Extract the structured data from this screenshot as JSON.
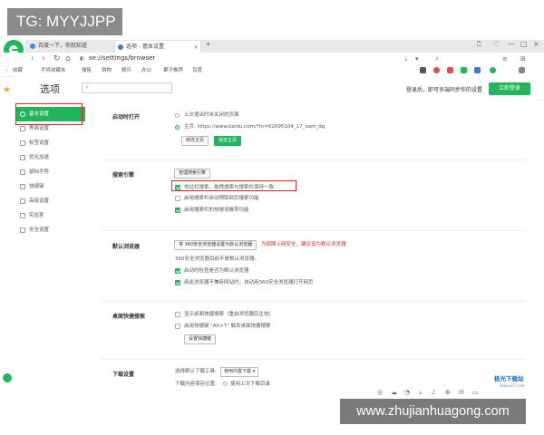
{
  "overlay_tag": "TG: MYYJJPP",
  "tabs": [
    {
      "label": "百度一下，你就知道",
      "active": false
    },
    {
      "label": "选项 - 基本设置",
      "active": true
    }
  ],
  "window_controls": {
    "new_tab": "+",
    "pin": "⍞",
    "heart": "♡",
    "minimize": "—",
    "restore": "□",
    "close": "×"
  },
  "address_bar": {
    "url": "se://settings/browser"
  },
  "bookmarks": [
    "收藏",
    "手机收藏夹",
    "搜售",
    "购物",
    "娱乐",
    "办公",
    "果子推荐",
    "百度"
  ],
  "header": {
    "title": "选项",
    "search_placeholder": "",
    "login_prompt": "登录后，即可多端同步你的设置",
    "login_button": "立即登录"
  },
  "sidebar": {
    "items": [
      {
        "label": "基本设置",
        "active": true
      },
      {
        "label": "界面设置",
        "active": false
      },
      {
        "label": "标签设置",
        "active": false
      },
      {
        "label": "优化加速",
        "active": false
      },
      {
        "label": "鼠标手势",
        "active": false
      },
      {
        "label": "快捷键",
        "active": false
      },
      {
        "label": "高级设置",
        "active": false
      },
      {
        "label": "实验室",
        "active": false
      },
      {
        "label": "安全设置",
        "active": false
      }
    ]
  },
  "sections": {
    "startup": {
      "title": "启动时打开",
      "opt1": "上次退出时未关闭的页面",
      "opt2": "主页: https://www.baidu.com/?tn=62095104_17_oem_dg",
      "btn_change": "修改主页",
      "btn_lock": "锁定主页"
    },
    "search": {
      "title": "搜索引擎",
      "btn_manage": "管理搜索引擎",
      "cb1": "地址栏搜索、拖拽搜索与搜索栏保持一致",
      "cb2": "启用搜索栏自动预取网页搜索功能",
      "cb3": "启用搜索栏的热搜词推荐功能"
    },
    "default_browser": {
      "title": "默认浏览器",
      "btn_set": "将 360安全浏览器设置为默认浏览器",
      "warn": "为保障上网安全，建议设为默认浏览器",
      "status": "360安全浏览器目前不是默认浏览器。",
      "cb1": "启动时检查是否为默认浏览器",
      "cb2": "用此浏览器不兼容网站时，自动用360安全浏览器打开网页"
    },
    "desktop_search": {
      "title": "桌面快捷搜索",
      "cb1": "显示桌面快捷搜索（重启浏览器后生效）",
      "cb2": "启用快捷键 \"Alt+T\" 触发桌面快捷搜索",
      "btn_set": "设置快捷键"
    },
    "download": {
      "title": "下载设置",
      "label1": "选择默认下载工具:",
      "select1": "使用内置下载",
      "label2": "下载内容保存位置:",
      "opt_last": "使用上次下载目录"
    }
  },
  "watermark": {
    "text": "www.zhujianhuagong.com",
    "logo": "极光下载站",
    "logo_sub": "www.xz7.com"
  },
  "colors": {
    "accent": "#20b55a",
    "warning": "#e02020",
    "highlight_box": "#e02020"
  }
}
